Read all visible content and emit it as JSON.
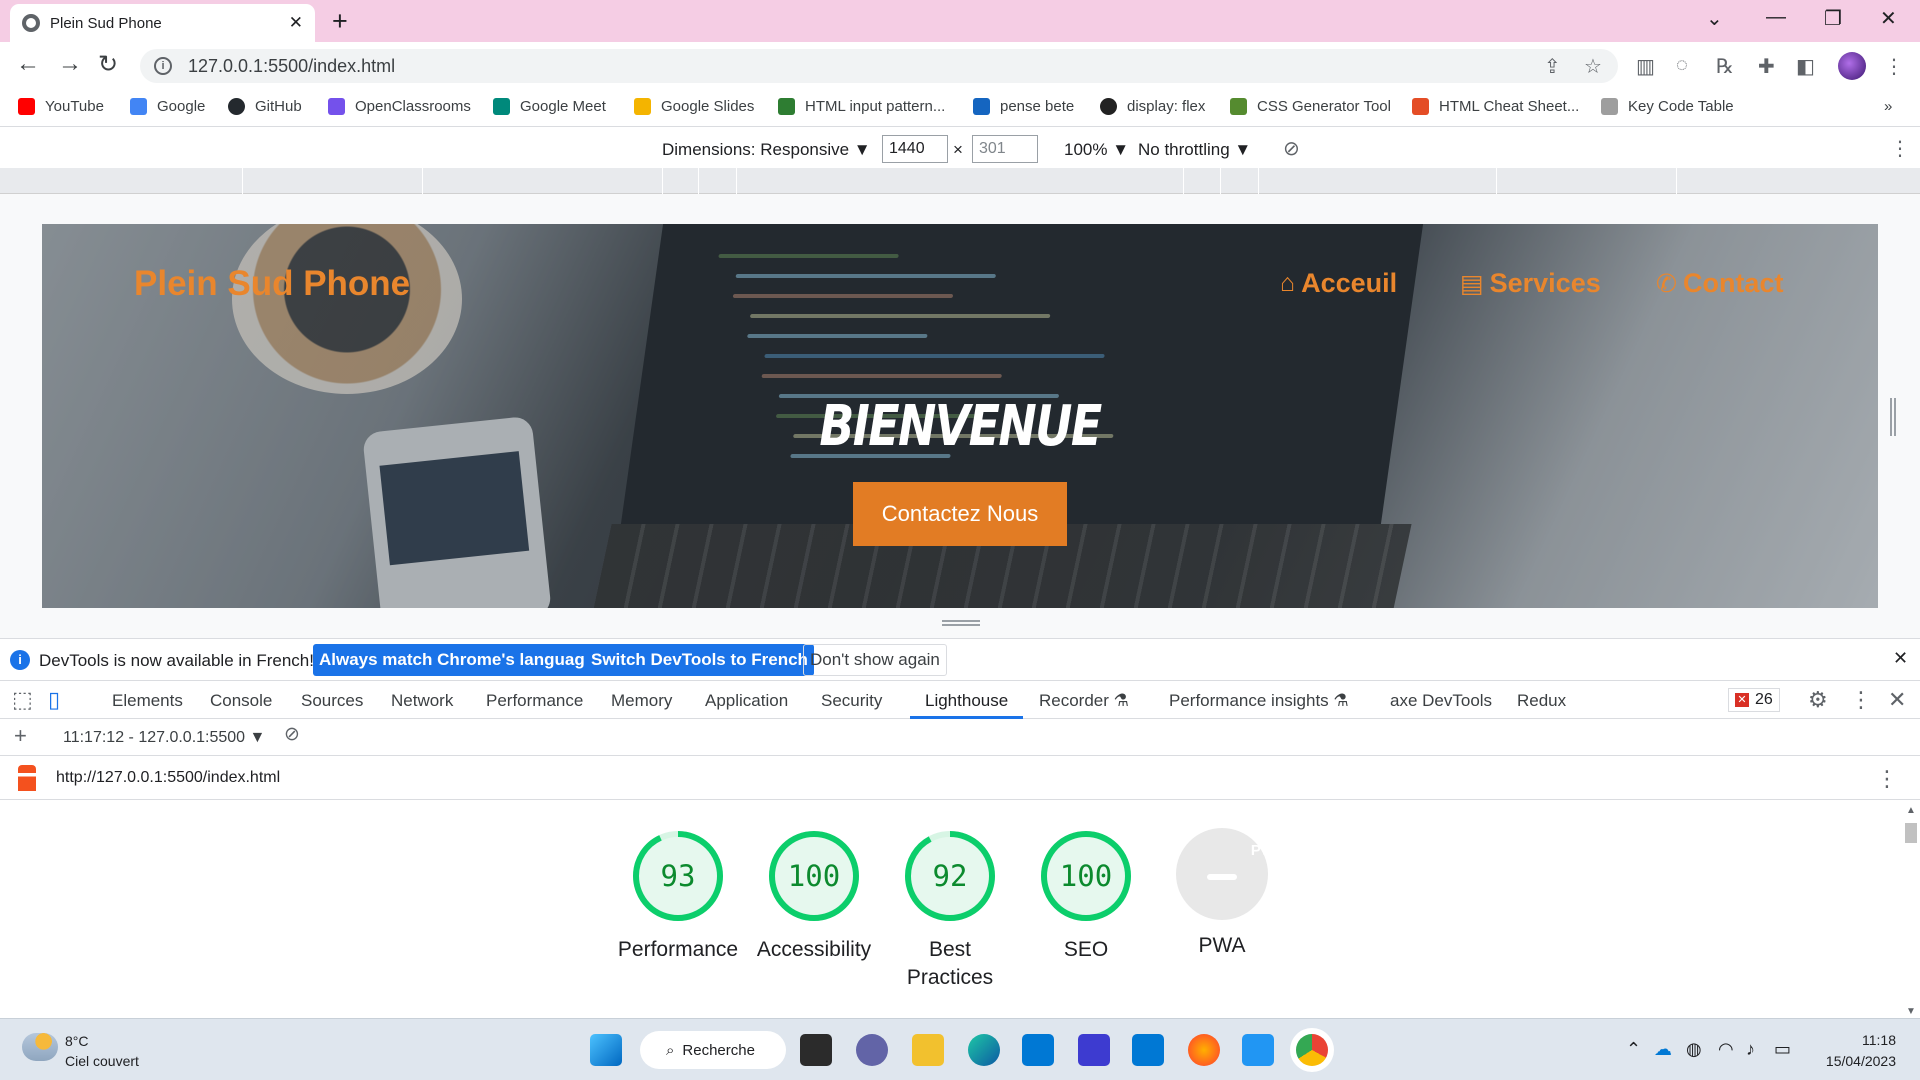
{
  "browser": {
    "tab_title": "Plein Sud Phone",
    "tab_close": "✕",
    "new_tab": "+",
    "url": "127.0.0.1:5500/index.html",
    "bookmarks": [
      {
        "label": "YouTube",
        "color": "#ff0000"
      },
      {
        "label": "Google",
        "color": "#4285f4"
      },
      {
        "label": "GitHub",
        "color": "#24292e"
      },
      {
        "label": "OpenClassrooms",
        "color": "#7451eb"
      },
      {
        "label": "Google Meet",
        "color": "#00897b"
      },
      {
        "label": "Google Slides",
        "color": "#f4b400"
      },
      {
        "label": "HTML input pattern...",
        "color": "#2e7d32"
      },
      {
        "label": "pense bete",
        "color": "#1565c0"
      },
      {
        "label": "display: flex",
        "color": "#222222"
      },
      {
        "label": "CSS Generator Tool",
        "color": "#558b2f"
      },
      {
        "label": "HTML Cheat Sheet...",
        "color": "#e44d26"
      },
      {
        "label": "Key Code Table",
        "color": "#9e9e9e"
      }
    ],
    "more_bookmarks": "»"
  },
  "device_toolbar": {
    "dimensions_label": "Dimensions: Responsive ▼",
    "width": "1440",
    "times": "×",
    "height": "301",
    "zoom": "100% ▼",
    "throttling": "No throttling ▼"
  },
  "site": {
    "title": "Plein Sud Phone",
    "nav": [
      {
        "label": "Acceuil",
        "icon": "home-icon",
        "glyph": "⌂"
      },
      {
        "label": "Services",
        "icon": "list-icon",
        "glyph": "▤"
      },
      {
        "label": "Contact",
        "icon": "phone-icon",
        "glyph": "✆"
      }
    ],
    "welcome": "BIENVENUE",
    "cta": "Contactez Nous",
    "accent": "#e9862d"
  },
  "infobar": {
    "message": "DevTools is now available in French!",
    "btn_match": "Always match Chrome's language",
    "btn_switch": "Switch DevTools to French",
    "btn_dismiss": "Don't show again"
  },
  "devtools": {
    "tabs": [
      "Elements",
      "Console",
      "Sources",
      "Network",
      "Performance",
      "Memory",
      "Application",
      "Security",
      "Lighthouse",
      "Recorder ⚗",
      "Performance insights ⚗",
      "axe DevTools",
      "Redux"
    ],
    "active_tab": "Lighthouse",
    "error_count": "26",
    "report_select": "11:17:12 - 127.0.0.1:5500 ▼",
    "report_url": "http://127.0.0.1:5500/index.html"
  },
  "lighthouse": {
    "scores": [
      {
        "label": "Performance",
        "score": 93,
        "fraction": 0.93
      },
      {
        "label": "Accessibility",
        "score": 100,
        "fraction": 1.0
      },
      {
        "label": "Best Practices",
        "score": 92,
        "fraction": 0.92
      },
      {
        "label": "SEO",
        "score": 100,
        "fraction": 1.0
      }
    ],
    "pwa_label": "PWA",
    "pwa_badge": "PWA",
    "good_color": "#0cce6b"
  },
  "taskbar": {
    "temperature": "8°C",
    "condition": "Ciel couvert",
    "search": "Recherche",
    "time": "11:18",
    "date": "15/04/2023"
  }
}
